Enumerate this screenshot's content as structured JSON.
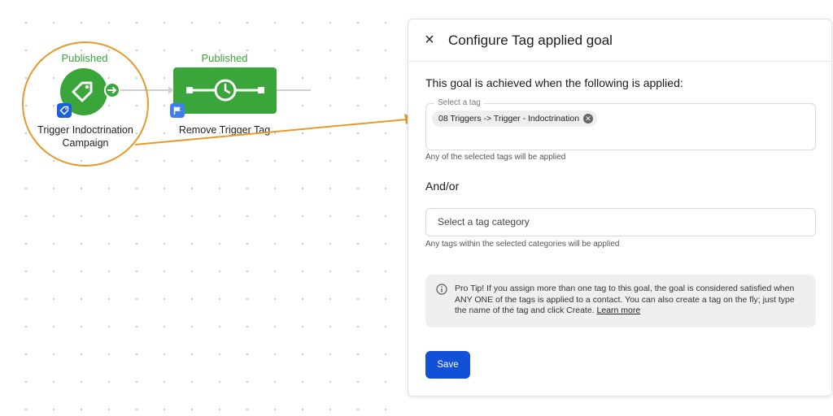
{
  "canvas": {
    "nodes": [
      {
        "status": "Published",
        "caption_line1": "Trigger Indoctrination",
        "caption_line2": "Campaign"
      },
      {
        "status": "Published",
        "caption_line1": "Remove Trigger Tag"
      }
    ],
    "colors": {
      "node_green": "#3aa53a",
      "highlight": "#e59a2a",
      "badge_blue": "#1a5fe0"
    }
  },
  "modal": {
    "close_icon": "×",
    "title": "Configure Tag applied goal",
    "description": "This goal is achieved when the following is applied:",
    "tag_field": {
      "label": "Select a tag",
      "chips": [
        "08 Triggers -> Trigger - Indoctrination"
      ],
      "hint": "Any of the selected tags will be applied"
    },
    "andor": "And/or",
    "category_field": {
      "placeholder": "Select a tag category",
      "hint": "Any tags within the selected categories will be applied"
    },
    "tip": {
      "text": "Pro Tip! If you assign more than one tag to this goal, the goal is considered satisfied when ANY ONE of the tags is applied to a contact. You can also create a tag on the fly; just type the name of the tag and click Create.",
      "link": "Learn more"
    },
    "save_label": "Save",
    "colors": {
      "primary": "#1350d8",
      "tip_bg": "#efefef"
    }
  }
}
